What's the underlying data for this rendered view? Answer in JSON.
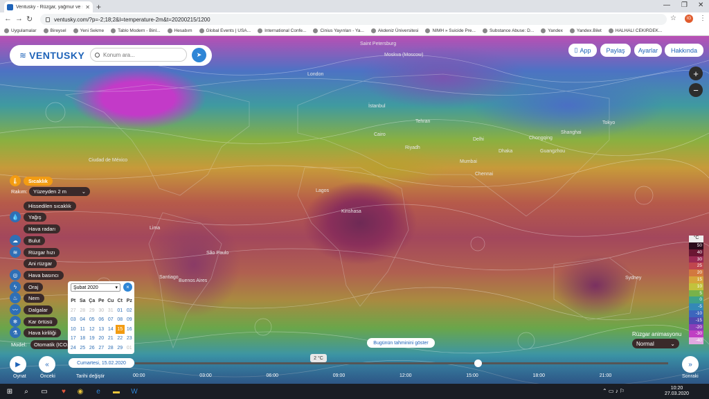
{
  "browser": {
    "tab_title": "Ventusky - Rüzgar, yağmur ve sı...",
    "new_tab": "+",
    "url": "ventusky.com/?p=-2;18;2&l=temperature-2m&t=20200215/1200",
    "avatar": "IG",
    "bookmarks": [
      {
        "label": "Uygulamalar"
      },
      {
        "label": "Bireysel"
      },
      {
        "label": "Yeni Sekme"
      },
      {
        "label": "Tablo Modern - Binl..."
      },
      {
        "label": "Hesabım"
      },
      {
        "label": "Global Events | USA..."
      },
      {
        "label": "International Confe..."
      },
      {
        "label": "Cinius Yayınları - Ya..."
      },
      {
        "label": "Akdeniz Üniversitesi"
      },
      {
        "label": "NIMH » Suicide Pre..."
      },
      {
        "label": "Substance Abuse: D..."
      },
      {
        "label": "Yandex"
      },
      {
        "label": "Yandex.Bilet"
      },
      {
        "label": "HALHALI CEKIRDEK..."
      }
    ]
  },
  "header": {
    "brand": "VENTUSKY",
    "search_placeholder": "Konum ara...",
    "buttons": {
      "app": "App",
      "share": "Paylaş",
      "settings": "Ayarlar",
      "about": "Hakkında"
    },
    "zoom_in": "+",
    "zoom_out": "−"
  },
  "map": {
    "cities": [
      {
        "name": "Saint Petersburg",
        "id": "stpetersburg"
      },
      {
        "name": "Moskva (Moscow)",
        "id": "moscow"
      },
      {
        "name": "London",
        "id": "london"
      },
      {
        "name": "İstanbul",
        "id": "istanbul"
      },
      {
        "name": "Tehran",
        "id": "tehran"
      },
      {
        "name": "Cairo",
        "id": "cairo"
      },
      {
        "name": "Riyadh",
        "id": "riyadh"
      },
      {
        "name": "Delhi",
        "id": "delhi"
      },
      {
        "name": "Mumbai",
        "id": "mumbai"
      },
      {
        "name": "Chennai",
        "id": "chennai"
      },
      {
        "name": "Dhaka",
        "id": "dhaka"
      },
      {
        "name": "Chongqing",
        "id": "chongqing"
      },
      {
        "name": "Shanghai",
        "id": "shanghai"
      },
      {
        "name": "Tokyo",
        "id": "tokyo"
      },
      {
        "name": "Guangzhou",
        "id": "guangzhou"
      },
      {
        "name": "Kinshasa",
        "id": "kinshasa"
      },
      {
        "name": "Lagos",
        "id": "lagos"
      },
      {
        "name": "Ciudad de México",
        "id": "mexico"
      },
      {
        "name": "Lima",
        "id": "lima"
      },
      {
        "name": "São Paulo",
        "id": "saopaulo"
      },
      {
        "name": "Santiago",
        "id": "santiago"
      },
      {
        "name": "Buenos Aires",
        "id": "buenosaires"
      },
      {
        "name": "Sydney",
        "id": "sydney"
      }
    ]
  },
  "layers": {
    "active": "Sıcaklık",
    "level_label": "Rakım:",
    "level_value": "Yüzeyden 2 m",
    "items": [
      {
        "label": "Sıcaklık",
        "icon": "thermometer-icon"
      },
      {
        "label": "Hissedilen sıcaklık",
        "icon": ""
      },
      {
        "label": "Yağış",
        "icon": "rain-drop-icon"
      },
      {
        "label": "Hava radarı",
        "icon": ""
      },
      {
        "label": "Bulut",
        "icon": "cloud-icon"
      },
      {
        "label": "Rüzgar hızı",
        "icon": "wind-icon"
      },
      {
        "label": "Ani rüzgar",
        "icon": ""
      },
      {
        "label": "Hava basıncı",
        "icon": "pressure-icon"
      },
      {
        "label": "Oraj",
        "icon": "lightning-icon"
      },
      {
        "label": "Nem",
        "icon": "humidity-icon"
      },
      {
        "label": "Dalgalar",
        "icon": "waves-icon"
      },
      {
        "label": "Kar örtüsü",
        "icon": "snowflake-icon"
      },
      {
        "label": "Hava kirliliği",
        "icon": "pollution-icon"
      }
    ],
    "model_label": "Model:",
    "model_value": "Otomatik (ICO..."
  },
  "calendar": {
    "month": "Şubat 2020",
    "close": "×",
    "weekdays": [
      "Pt",
      "Sa",
      "Ça",
      "Pe",
      "Cu",
      "Ct",
      "Pz"
    ],
    "days": [
      [
        "27",
        "28",
        "29",
        "30",
        "31",
        "01",
        "02"
      ],
      [
        "03",
        "04",
        "05",
        "06",
        "07",
        "08",
        "09"
      ],
      [
        "10",
        "11",
        "12",
        "13",
        "14",
        "15",
        "16"
      ],
      [
        "17",
        "18",
        "19",
        "20",
        "21",
        "22",
        "23"
      ],
      [
        "24",
        "25",
        "26",
        "27",
        "28",
        "29",
        "01"
      ]
    ],
    "selected_day": "15"
  },
  "legend": {
    "unit": "°C",
    "steps": [
      {
        "v": "50",
        "c": "#2b0b1b"
      },
      {
        "v": "40",
        "c": "#6b1633"
      },
      {
        "v": "30",
        "c": "#9c2a54"
      },
      {
        "v": "25",
        "c": "#c0464e"
      },
      {
        "v": "20",
        "c": "#d2783f"
      },
      {
        "v": "15",
        "c": "#d6a53a"
      },
      {
        "v": "10",
        "c": "#c2c23c"
      },
      {
        "v": "5",
        "c": "#78b24a"
      },
      {
        "v": "0",
        "c": "#3ea28a"
      },
      {
        "v": "-5",
        "c": "#3489b7"
      },
      {
        "v": "-10",
        "c": "#3d66bd"
      },
      {
        "v": "-15",
        "c": "#5048b0"
      },
      {
        "v": "-20",
        "c": "#8a3db8"
      },
      {
        "v": "-30",
        "c": "#c03fc3"
      },
      {
        "v": "-40",
        "c": "#e0a8e0"
      }
    ]
  },
  "timeline": {
    "play": "Oynat",
    "prev": "Önceki",
    "next": "Sonraki",
    "change_date": "Tarihi değiştir",
    "date": "Cumartesi, 15.02.2020",
    "temp_readout": "2 °C",
    "forecast_button": "Bugünün tahminini göster",
    "anim_label": "Rüzgar animasyonu",
    "anim_value": "Normal",
    "hours": [
      "00:00",
      "03:00",
      "06:00",
      "09:00",
      "12:00",
      "15:00",
      "18:00",
      "21:00"
    ],
    "current_fraction": 0.643
  },
  "taskbar": {
    "time": "10:20",
    "date": "27.03.2020"
  }
}
